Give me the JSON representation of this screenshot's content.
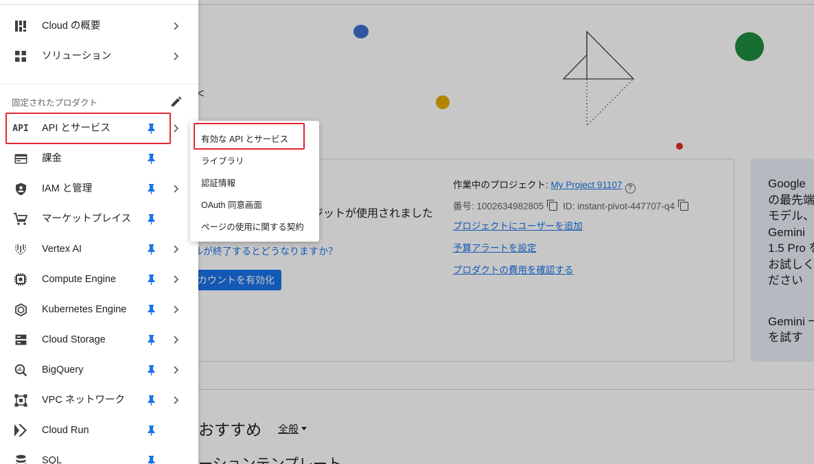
{
  "background": {
    "credit_text": "ジットが使用されました",
    "trial_link": "ルが終了するとどうなりますか？",
    "activate_button": "カウントを有効化",
    "project": {
      "label": "作業中のプロジェクト: ",
      "name": "My Project 91107",
      "number_label": "番号: 1002634982805",
      "id_label": "ID: instant-pivot-447707-q4",
      "links": [
        "プロジェクトにユーザーを追加",
        "予算アラートを設定",
        "プロダクトの費用を確認する"
      ]
    },
    "gemini_card": {
      "text": "Google\nの最先端\nモデル、\nGemini\n1.5 Pro を\nお試しく\nださい",
      "try_text": "Gemini 一\nを試す"
    },
    "recommend_heading": "おすすめ",
    "recommend_filter": "全般",
    "template_heading": "ーションテンプレート",
    "colors": {
      "blue_dot": "#3b6fd1",
      "yellow_dot": "#e5a900",
      "green_dot": "#1e8e3e",
      "red_dot": "#d93025"
    }
  },
  "sidenav": {
    "top_items": [
      {
        "label": "Cloud の概要",
        "icon": "dashboard-icon"
      },
      {
        "label": "ソリューション",
        "icon": "grid-icon"
      }
    ],
    "pinned_section_label": "固定されたプロダクト",
    "pinned_items": [
      {
        "label": "API とサービス",
        "icon": "api-icon",
        "has_submenu": true
      },
      {
        "label": "課金",
        "icon": "billing-icon",
        "has_submenu": false
      },
      {
        "label": "IAM と管理",
        "icon": "shield-icon",
        "has_submenu": true
      },
      {
        "label": "マーケットプレイス",
        "icon": "cart-icon",
        "has_submenu": false
      },
      {
        "label": "Vertex AI",
        "icon": "vertex-ai-icon",
        "has_submenu": true
      },
      {
        "label": "Compute Engine",
        "icon": "chip-icon",
        "has_submenu": true
      },
      {
        "label": "Kubernetes Engine",
        "icon": "kubernetes-icon",
        "has_submenu": true
      },
      {
        "label": "Cloud Storage",
        "icon": "storage-icon",
        "has_submenu": true
      },
      {
        "label": "BigQuery",
        "icon": "bigquery-icon",
        "has_submenu": true
      },
      {
        "label": "VPC ネットワーク",
        "icon": "network-icon",
        "has_submenu": true
      },
      {
        "label": "Cloud Run",
        "icon": "cloud-run-icon",
        "has_submenu": false
      },
      {
        "label": "SQL",
        "icon": "sql-icon",
        "has_submenu": false
      }
    ],
    "colors": {
      "pin": "#1a73e8",
      "highlight": "#e0262d"
    }
  },
  "flyout": {
    "items": [
      "有効な API とサービス",
      "ライブラリ",
      "認証情報",
      "OAuth 同意画面",
      "ページの使用に関する契約"
    ]
  }
}
